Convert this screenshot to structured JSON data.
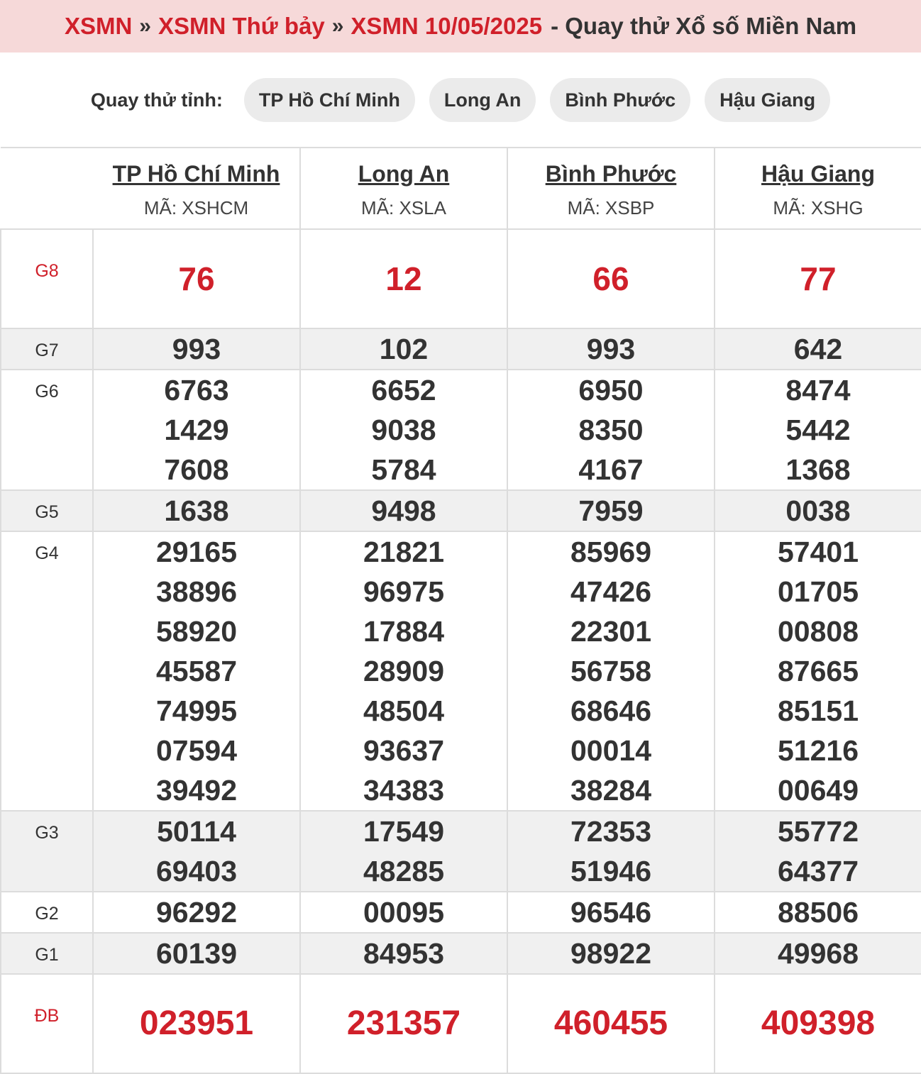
{
  "breadcrumb": {
    "item1": "XSMN",
    "item2": "XSMN Thứ bảy",
    "item3": "XSMN 10/05/2025",
    "suffix": "- Quay thử Xổ số Miền Nam"
  },
  "quay_thu": {
    "label": "Quay thử tỉnh:",
    "provinces": [
      "TP Hồ Chí Minh",
      "Long An",
      "Bình Phước",
      "Hậu Giang"
    ]
  },
  "table": {
    "provinces": [
      {
        "name": "TP Hồ Chí Minh",
        "code": "MÃ: XSHCM"
      },
      {
        "name": "Long An",
        "code": "MÃ: XSLA"
      },
      {
        "name": "Bình Phước",
        "code": "MÃ: XSBP"
      },
      {
        "name": "Hậu Giang",
        "code": "MÃ: XSHG"
      }
    ],
    "prizes": [
      {
        "label": "G8",
        "style": "g8",
        "values": [
          [
            "76"
          ],
          [
            "12"
          ],
          [
            "66"
          ],
          [
            "77"
          ]
        ]
      },
      {
        "label": "G7",
        "style": "shade",
        "values": [
          [
            "993"
          ],
          [
            "102"
          ],
          [
            "993"
          ],
          [
            "642"
          ]
        ]
      },
      {
        "label": "G6",
        "style": "plain",
        "values": [
          [
            "6763",
            "1429",
            "7608"
          ],
          [
            "6652",
            "9038",
            "5784"
          ],
          [
            "6950",
            "8350",
            "4167"
          ],
          [
            "8474",
            "5442",
            "1368"
          ]
        ]
      },
      {
        "label": "G5",
        "style": "shade",
        "values": [
          [
            "1638"
          ],
          [
            "9498"
          ],
          [
            "7959"
          ],
          [
            "0038"
          ]
        ]
      },
      {
        "label": "G4",
        "style": "plain",
        "values": [
          [
            "29165",
            "38896",
            "58920",
            "45587",
            "74995",
            "07594",
            "39492"
          ],
          [
            "21821",
            "96975",
            "17884",
            "28909",
            "48504",
            "93637",
            "34383"
          ],
          [
            "85969",
            "47426",
            "22301",
            "56758",
            "68646",
            "00014",
            "38284"
          ],
          [
            "57401",
            "01705",
            "00808",
            "87665",
            "85151",
            "51216",
            "00649"
          ]
        ]
      },
      {
        "label": "G3",
        "style": "shade",
        "values": [
          [
            "50114",
            "69403"
          ],
          [
            "17549",
            "48285"
          ],
          [
            "72353",
            "51946"
          ],
          [
            "55772",
            "64377"
          ]
        ]
      },
      {
        "label": "G2",
        "style": "plain",
        "values": [
          [
            "96292"
          ],
          [
            "00095"
          ],
          [
            "96546"
          ],
          [
            "88506"
          ]
        ]
      },
      {
        "label": "G1",
        "style": "shade",
        "values": [
          [
            "60139"
          ],
          [
            "84953"
          ],
          [
            "98922"
          ],
          [
            "49968"
          ]
        ]
      },
      {
        "label": "ĐB",
        "style": "db",
        "values": [
          [
            "023951"
          ],
          [
            "231357"
          ],
          [
            "460455"
          ],
          [
            "409398"
          ]
        ]
      }
    ]
  },
  "colors": {
    "accent_red": "#d0202a",
    "header_bg": "#f6d9d9",
    "pill_bg": "#ebebeb",
    "shade_bg": "#f0f0f0"
  }
}
